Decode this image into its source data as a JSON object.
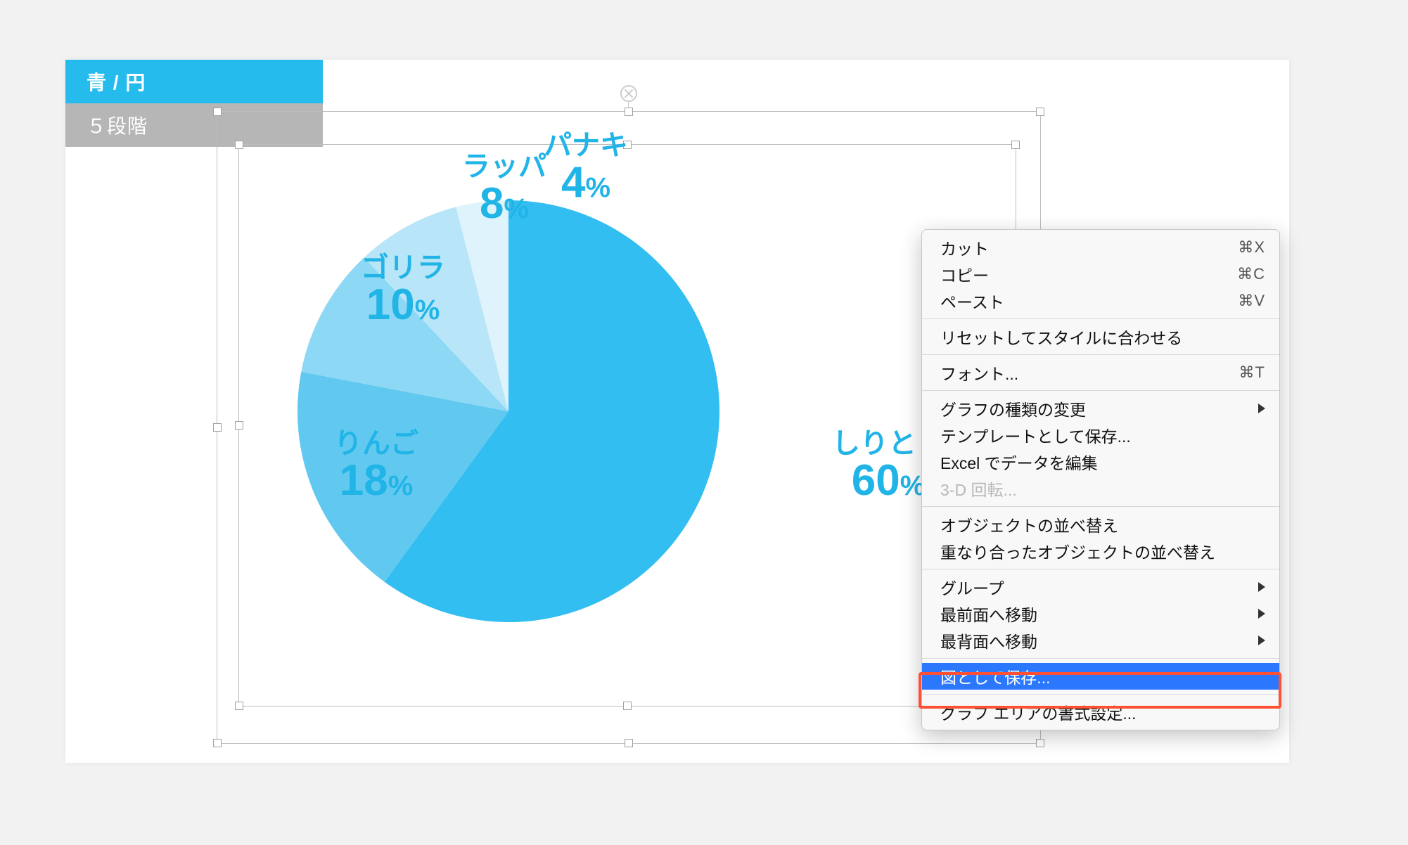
{
  "tabs": {
    "active_label": "青 / 円",
    "inactive_label": "５段階"
  },
  "chart_data": {
    "type": "pie",
    "categories": [
      "しりとり",
      "りんご",
      "ゴリラ",
      "ラッパ",
      "パナキ"
    ],
    "values": [
      60,
      18,
      10,
      8,
      4
    ],
    "colors": [
      "#33bef1",
      "#61c9f0",
      "#8dd8f4",
      "#b8e6f8",
      "#def3fb"
    ],
    "title": "",
    "unit": "%"
  },
  "labels": {
    "p0": {
      "name": "しりとり",
      "value": "60",
      "pct": "%"
    },
    "p1": {
      "name": "りんご",
      "value": "18",
      "pct": "%"
    },
    "p2": {
      "name": "ゴリラ",
      "value": "10",
      "pct": "%"
    },
    "p3": {
      "name": "ラッパ",
      "value": "8",
      "pct": "%"
    },
    "p4": {
      "name": "パナキ",
      "value": "4",
      "pct": "%"
    }
  },
  "context_menu": {
    "cut": {
      "label": "カット",
      "shortcut": "⌘X"
    },
    "copy": {
      "label": "コピー",
      "shortcut": "⌘C"
    },
    "paste": {
      "label": "ペースト",
      "shortcut": "⌘V"
    },
    "reset": {
      "label": "リセットしてスタイルに合わせる"
    },
    "font": {
      "label": "フォント...",
      "shortcut": "⌘T"
    },
    "changetype": {
      "label": "グラフの種類の変更"
    },
    "savetmpl": {
      "label": "テンプレートとして保存..."
    },
    "excel": {
      "label": "Excel でデータを編集"
    },
    "rot3d": {
      "label": "3-D 回転..."
    },
    "reorder": {
      "label": "オブジェクトの並べ替え"
    },
    "reorder2": {
      "label": "重なり合ったオブジェクトの並べ替え"
    },
    "group": {
      "label": "グループ"
    },
    "front": {
      "label": "最前面へ移動"
    },
    "back": {
      "label": "最背面へ移動"
    },
    "savepic": {
      "label": "図として保存..."
    },
    "format": {
      "label": "グラフ エリアの書式設定..."
    }
  }
}
